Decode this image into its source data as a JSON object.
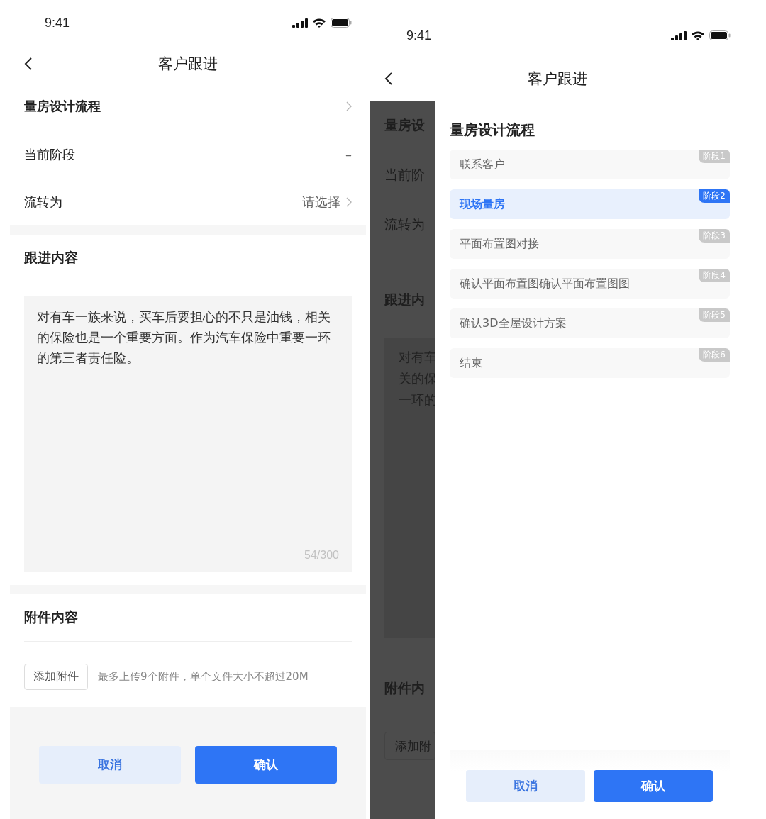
{
  "form_screen": {
    "status_bar": {
      "time": "9:41"
    },
    "nav": {
      "title": "客户跟进"
    },
    "rows": [
      {
        "label": "量房设计流程",
        "kind": "link"
      },
      {
        "label": "当前阶段",
        "kind": "value",
        "value": "–"
      },
      {
        "label": "流转为",
        "kind": "select",
        "value": "请选择"
      }
    ],
    "follow_up": {
      "title": "跟进内容",
      "value": "对有车一族来说，买车后要担心的不只是油钱，相关的保险也是一个重要方面。作为汽车保险中重要一环的第三者责任险。",
      "counter": "54/300"
    },
    "attachments": {
      "title": "附件内容",
      "button": "添加附件",
      "hint": "最多上传9个附件，单个文件大小不超过20M"
    },
    "buttons": [
      {
        "label": "取消",
        "kind": "secondary"
      },
      {
        "label": "确认",
        "kind": "primary"
      }
    ]
  },
  "picker_screen": {
    "status_bar": {
      "time": "9:41"
    },
    "nav": {
      "title": "客户跟进"
    },
    "background": {
      "rows": [
        "量房设",
        "当前阶",
        "流转为"
      ],
      "section_title": "跟进内",
      "text_lines": [
        "对有车",
        "关的保",
        "一环的"
      ],
      "attachment_title": "附件内",
      "button": "添加附"
    },
    "drawer": {
      "title": "量房设计流程",
      "stages": [
        {
          "name": "联系客户",
          "badge": "阶段1",
          "selected": false
        },
        {
          "name": "现场量房",
          "badge": "阶段2",
          "selected": true
        },
        {
          "name": "平面布置图对接",
          "badge": "阶段3",
          "selected": false
        },
        {
          "name": "确认平面布置图确认平面布置图图",
          "badge": "阶段4",
          "selected": false
        },
        {
          "name": "确认3D全屋设计方案",
          "badge": "阶段5",
          "selected": false
        },
        {
          "name": "结束",
          "badge": "阶段6",
          "selected": false
        }
      ],
      "buttons": [
        {
          "label": "取消",
          "kind": "secondary"
        },
        {
          "label": "确认",
          "kind": "primary"
        }
      ]
    }
  }
}
